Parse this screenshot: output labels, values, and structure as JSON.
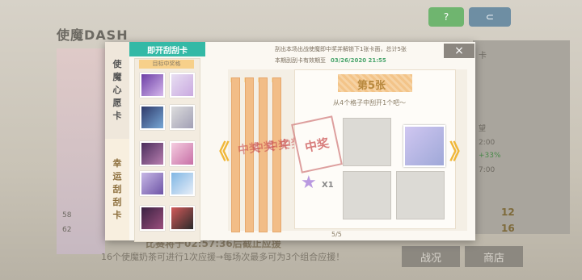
{
  "background": {
    "title": "使魔DASH",
    "top_button_left": "?",
    "top_button_right": "⊂",
    "countdown": "比赛将于02:57:36后截止应援",
    "bottom_note": "16个使魔奶茶可进行1次应援→每场次最多可为3个组合应援！",
    "battle_label": "战况",
    "shop_label": "商店",
    "right_label": "卡",
    "right_small": [
      "望",
      "2:00",
      "+33%",
      "7:00"
    ],
    "right_nums": [
      "12",
      "16"
    ],
    "left_nums": [
      "58",
      "62"
    ]
  },
  "modal": {
    "close_label": "×",
    "tabs": [
      {
        "label": "使魔心愿卡",
        "active": true
      },
      {
        "label": "幸运刮刮卡",
        "active": false
      }
    ],
    "target_header": "即开刮刮卡",
    "target_sub": "目标中奖格",
    "top_line1": "刮出本场出战使魔即中奖并解锁下1张卡面，总计5张",
    "top_line2_prefix": "本期刮刮卡有效期至",
    "top_line2_date": "03/26/2020 21:55",
    "card_title": "第5张",
    "card_sub": "从4个格子中刮开1个吧～",
    "stamp_text": "中奖",
    "prize_count": "X1",
    "page_indicator": "5/5",
    "arrow_left": "《",
    "arrow_right": "》"
  },
  "colors": {
    "accent": "#34b9a6",
    "orange": "#f2bd87",
    "stamp": "#c94a4a",
    "date": "#4aa56d"
  }
}
